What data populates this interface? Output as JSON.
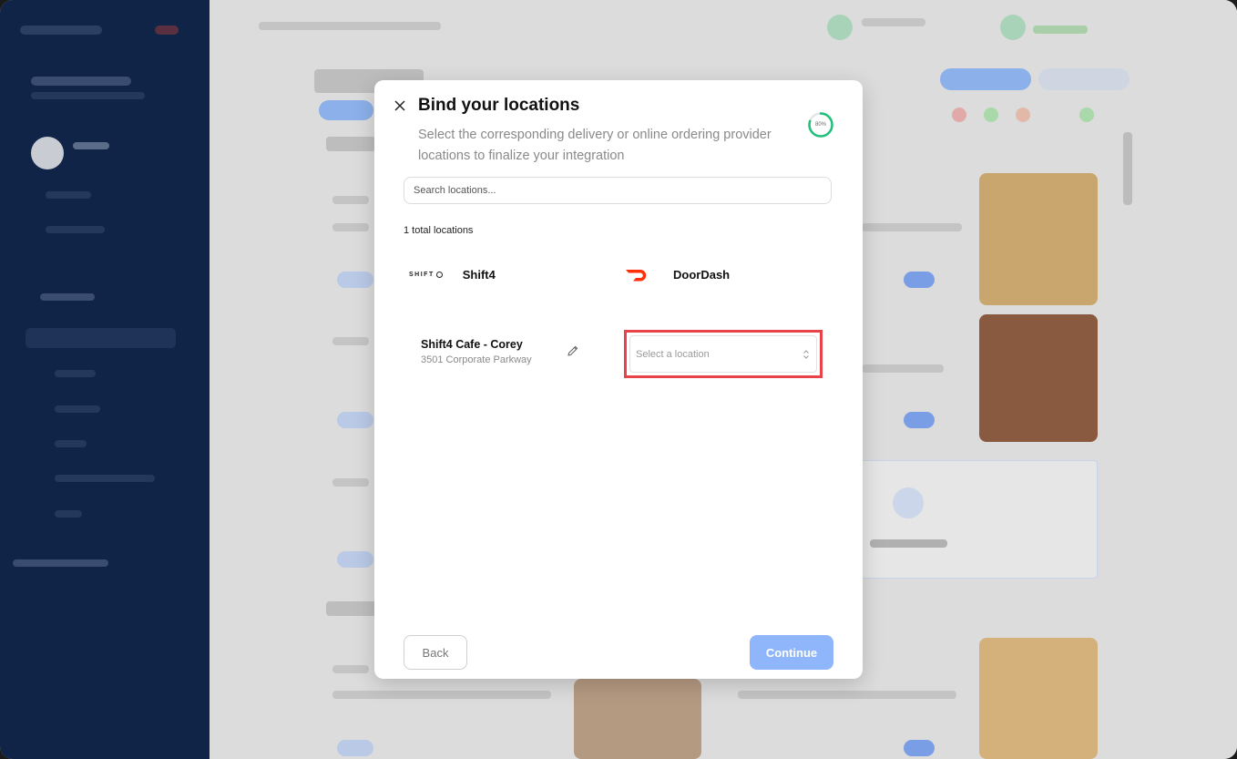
{
  "modal": {
    "title": "Bind your locations",
    "subtitle": "Select the corresponding delivery or online ordering provider locations to finalize your integration",
    "progress_label": "80%",
    "progress_value": 0.8,
    "search_placeholder": "Search locations...",
    "total_locations": "1 total locations",
    "providers": {
      "left": {
        "logo_text": "SHIFT",
        "name": "Shift4"
      },
      "right": {
        "name": "DoorDash"
      }
    },
    "location": {
      "name": "Shift4 Cafe - Corey",
      "address": "3501 Corporate Parkway"
    },
    "select_placeholder": "Select a location",
    "back_label": "Back",
    "continue_label": "Continue"
  },
  "colors": {
    "accent": "#8fb6fb",
    "progress": "#20c07a",
    "highlight": "#e8424b",
    "doordash": "#ff3008",
    "sidebar": "#0f2447"
  }
}
